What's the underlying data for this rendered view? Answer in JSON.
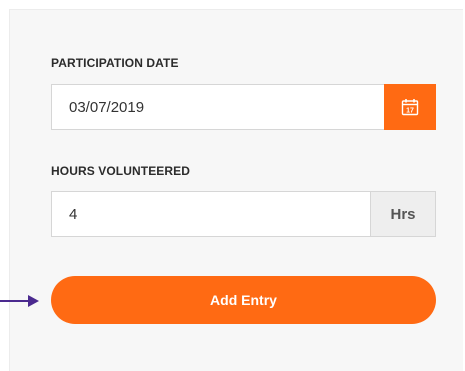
{
  "form": {
    "participation_date": {
      "label": "PARTICIPATION DATE",
      "value": "03/07/2019",
      "calendar_icon_day": "17"
    },
    "hours_volunteered": {
      "label": "HOURS VOLUNTEERED",
      "value": "4",
      "unit": "Hrs"
    },
    "submit_label": "Add Entry"
  },
  "colors": {
    "accent": "#ff6a13",
    "pointer_arrow": "#4b2a8f"
  },
  "icons": {
    "calendar": "calendar-icon",
    "pointer": "arrow-right-icon"
  }
}
